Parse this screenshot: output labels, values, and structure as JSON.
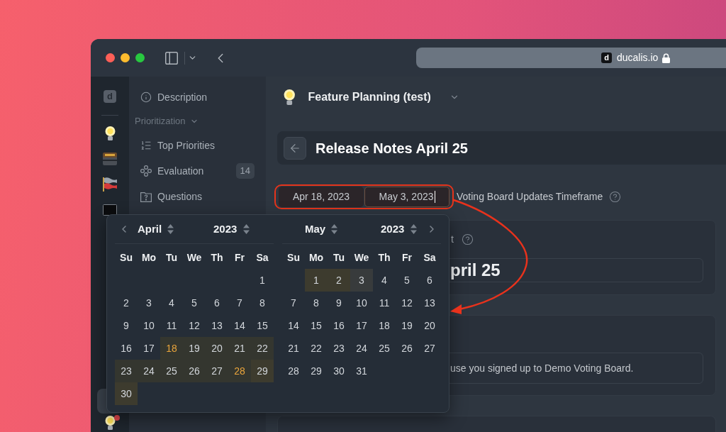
{
  "browser": {
    "favicon": "d",
    "url": "ducalis.io"
  },
  "rail": {
    "logo": "d",
    "top_items": [
      {
        "kind": "bulb",
        "selected": false,
        "notification": false
      },
      {
        "kind": "chest",
        "selected": false,
        "notification": false
      },
      {
        "kind": "flags",
        "selected": false,
        "notification": false
      },
      {
        "kind": "screen",
        "selected": false,
        "notification": false
      }
    ],
    "bottom_items": [
      {
        "kind": "hidden",
        "selected": true,
        "notification": false
      },
      {
        "kind": "bulb",
        "selected": false,
        "notification": true
      }
    ]
  },
  "nav": {
    "items": [
      {
        "label": "Description",
        "selected": false
      }
    ],
    "sections": [
      {
        "label": "Prioritization",
        "expanded": true,
        "items": [
          {
            "label": "Top Priorities",
            "selected": false
          },
          {
            "label": "Evaluation",
            "count": "14",
            "selected": false
          },
          {
            "label": "Questions",
            "selected": false
          }
        ]
      }
    ]
  },
  "project": {
    "title": "Feature Planning (test)"
  },
  "page_header": {
    "title": "Release Notes April 25"
  },
  "timeframe": {
    "inputs": [
      {
        "value": "Apr 18, 2023",
        "focused": false
      },
      {
        "value": "May 3, 2023",
        "focused": true
      }
    ],
    "label": "Voting Board Updates Timeframe"
  },
  "cards": [
    {
      "kind": "title",
      "label": "t",
      "value": "pril 25"
    },
    {
      "kind": "text",
      "value": "use you signed up to Demo Voting Board."
    },
    {
      "kind": "blank"
    }
  ],
  "date_picker": {
    "months": [
      {
        "month": "April",
        "year": "2023",
        "has_prev": true,
        "weekdays": [
          "Su",
          "Mo",
          "Tu",
          "We",
          "Th",
          "Fr",
          "Sa"
        ],
        "weeks": [
          [
            {
              "label": "1",
              "kind": "plain",
              "accent": false
            }
          ],
          [
            {
              "label": "2",
              "kind": "plain",
              "accent": false
            },
            {
              "label": "3",
              "kind": "plain",
              "accent": false
            },
            {
              "label": "4",
              "kind": "plain",
              "accent": false
            },
            {
              "label": "5",
              "kind": "plain",
              "accent": false
            },
            {
              "label": "6",
              "kind": "plain",
              "accent": false
            },
            {
              "label": "7",
              "kind": "plain",
              "accent": false
            },
            {
              "label": "8",
              "kind": "plain",
              "accent": false
            }
          ],
          [
            {
              "label": "9",
              "kind": "plain",
              "accent": false
            },
            {
              "label": "10",
              "kind": "plain",
              "accent": false
            },
            {
              "label": "11",
              "kind": "plain",
              "accent": false
            },
            {
              "label": "12",
              "kind": "plain",
              "accent": false
            },
            {
              "label": "13",
              "kind": "plain",
              "accent": false
            },
            {
              "label": "14",
              "kind": "plain",
              "accent": false
            },
            {
              "label": "15",
              "kind": "plain",
              "accent": false
            }
          ],
          [
            {
              "label": "16",
              "kind": "plain",
              "accent": false
            },
            {
              "label": "17",
              "kind": "plain",
              "accent": false
            },
            {
              "label": "18",
              "kind": "range",
              "accent": true
            },
            {
              "label": "19",
              "kind": "range",
              "accent": false
            },
            {
              "label": "20",
              "kind": "range",
              "accent": false
            },
            {
              "label": "21",
              "kind": "range",
              "accent": false
            },
            {
              "label": "22",
              "kind": "range",
              "accent": false
            }
          ],
          [
            {
              "label": "23",
              "kind": "range",
              "accent": false
            },
            {
              "label": "24",
              "kind": "range",
              "accent": false
            },
            {
              "label": "25",
              "kind": "range",
              "accent": false
            },
            {
              "label": "26",
              "kind": "range",
              "accent": false
            },
            {
              "label": "27",
              "kind": "range",
              "accent": false
            },
            {
              "label": "28",
              "kind": "range",
              "accent": true
            },
            {
              "label": "29",
              "kind": "preview",
              "accent": false
            }
          ],
          [
            {
              "label": "30",
              "kind": "preview",
              "accent": false
            }
          ]
        ]
      },
      {
        "month": "May",
        "year": "2023",
        "has_next": true,
        "weekdays": [
          "Su",
          "Mo",
          "Tu",
          "We",
          "Th",
          "Fr",
          "Sa"
        ],
        "weeks": [
          [
            {
              "label": "1",
              "kind": "preview",
              "accent": false
            },
            {
              "label": "2",
              "kind": "preview",
              "accent": false
            },
            {
              "label": "3",
              "kind": "hover",
              "accent": false
            },
            {
              "label": "4",
              "kind": "plain",
              "accent": false
            },
            {
              "label": "5",
              "kind": "plain",
              "accent": false
            },
            {
              "label": "6",
              "kind": "plain",
              "accent": false
            }
          ],
          [
            {
              "label": "7",
              "kind": "plain",
              "accent": false
            },
            {
              "label": "8",
              "kind": "plain",
              "accent": false
            },
            {
              "label": "9",
              "kind": "plain",
              "accent": false
            },
            {
              "label": "10",
              "kind": "plain",
              "accent": false
            },
            {
              "label": "11",
              "kind": "plain",
              "accent": false
            },
            {
              "label": "12",
              "kind": "plain",
              "accent": false
            },
            {
              "label": "13",
              "kind": "plain",
              "accent": false
            }
          ],
          [
            {
              "label": "14",
              "kind": "plain",
              "accent": false
            },
            {
              "label": "15",
              "kind": "plain",
              "accent": false
            },
            {
              "label": "16",
              "kind": "plain",
              "accent": false
            },
            {
              "label": "17",
              "kind": "plain",
              "accent": false
            },
            {
              "label": "18",
              "kind": "plain",
              "accent": false
            },
            {
              "label": "19",
              "kind": "plain",
              "accent": false
            },
            {
              "label": "20",
              "kind": "plain",
              "accent": false
            }
          ],
          [
            {
              "label": "21",
              "kind": "plain",
              "accent": false
            },
            {
              "label": "22",
              "kind": "plain",
              "accent": false
            },
            {
              "label": "23",
              "kind": "plain",
              "accent": false
            },
            {
              "label": "24",
              "kind": "plain",
              "accent": false
            },
            {
              "label": "25",
              "kind": "plain",
              "accent": false
            },
            {
              "label": "26",
              "kind": "plain",
              "accent": false
            },
            {
              "label": "27",
              "kind": "plain",
              "accent": false
            }
          ],
          [
            {
              "label": "28",
              "kind": "plain",
              "accent": false
            },
            {
              "label": "29",
              "kind": "plain",
              "accent": false
            },
            {
              "label": "30",
              "kind": "plain",
              "accent": false
            },
            {
              "label": "31",
              "kind": "plain",
              "accent": false
            }
          ]
        ]
      }
    ]
  }
}
